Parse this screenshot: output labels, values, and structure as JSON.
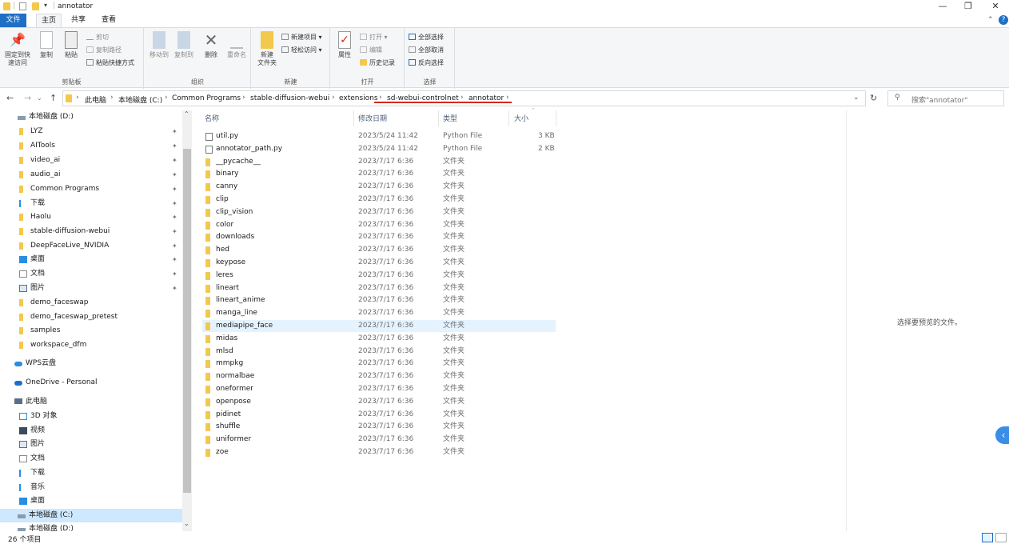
{
  "window": {
    "title": "annotator",
    "controls": {
      "minimize": "—",
      "maximize": "❐",
      "close": "✕"
    }
  },
  "ribbon_tabs": [
    {
      "label": "文件"
    },
    {
      "label": "主页"
    },
    {
      "label": "共享"
    },
    {
      "label": "查看"
    }
  ],
  "ribbon": {
    "clipboard": {
      "pin_label": "固定到快速访问",
      "copy_label": "复制",
      "paste_label": "粘贴",
      "cut_label": "剪切",
      "copy_path_label": "复制路径",
      "paste_shortcut_label": "粘贴快捷方式",
      "group_label": "剪贴板"
    },
    "organize": {
      "move_to_label": "移动到",
      "copy_to_label": "复制到",
      "delete_label": "删除",
      "rename_label": "重命名",
      "group_label": "组织"
    },
    "new": {
      "new_folder_label": "新建\n文件夹",
      "new_item_label": "新建项目",
      "easy_access_label": "轻松访问",
      "group_label": "新建"
    },
    "open": {
      "properties_label": "属性",
      "open_label": "打开",
      "edit_label": "编辑",
      "history_label": "历史记录",
      "group_label": "打开"
    },
    "select": {
      "select_all_label": "全部选择",
      "select_none_label": "全部取消",
      "invert_label": "反向选择",
      "group_label": "选择"
    }
  },
  "address": {
    "nav": {
      "back": "←",
      "forward": "→",
      "up": "↑"
    },
    "breadcrumbs": [
      "此电脑",
      "本地磁盘 (C:)",
      "Common Programs",
      "stable-diffusion-webui",
      "extensions",
      "sd-webui-controlnet",
      "annotator"
    ],
    "search_placeholder": "搜索\"annotator\""
  },
  "nav_pane": {
    "items": [
      {
        "label": "本地磁盘 (D:)",
        "icon": "drive-icon",
        "pinned": false
      },
      {
        "label": "LYZ",
        "icon": "folder-icon",
        "pinned": true
      },
      {
        "label": "AITools",
        "icon": "folder-icon",
        "pinned": true
      },
      {
        "label": "video_ai",
        "icon": "folder-icon",
        "pinned": true
      },
      {
        "label": "audio_ai",
        "icon": "folder-icon",
        "pinned": true
      },
      {
        "label": "Common Programs",
        "icon": "folder-icon",
        "pinned": true
      },
      {
        "label": "下载",
        "icon": "download-icon",
        "pinned": true
      },
      {
        "label": "Haolu",
        "icon": "folder-icon",
        "pinned": true
      },
      {
        "label": "stable-diffusion-webui",
        "icon": "folder-icon",
        "pinned": true
      },
      {
        "label": "DeepFaceLive_NVIDIA",
        "icon": "folder-icon",
        "pinned": true
      },
      {
        "label": "桌面",
        "icon": "desktop-icon",
        "pinned": true
      },
      {
        "label": "文档",
        "icon": "document-icon",
        "pinned": true
      },
      {
        "label": "图片",
        "icon": "picture-icon",
        "pinned": true
      },
      {
        "label": "demo_faceswap",
        "icon": "folder-icon",
        "pinned": false
      },
      {
        "label": "demo_faceswap_pretest",
        "icon": "folder-icon",
        "pinned": false
      },
      {
        "label": "samples",
        "icon": "folder-icon",
        "pinned": false
      },
      {
        "label": "workspace_dfm",
        "icon": "folder-icon",
        "pinned": false
      },
      {
        "label": "WPS云盘",
        "icon": "cloud-icon",
        "pinned": false
      },
      {
        "label": "OneDrive - Personal",
        "icon": "onedrive-icon",
        "pinned": false
      },
      {
        "label": "此电脑",
        "icon": "computer-icon",
        "pinned": false
      },
      {
        "label": "3D 对象",
        "icon": "3d-objects-icon",
        "pinned": false
      },
      {
        "label": "视频",
        "icon": "video-icon",
        "pinned": false
      },
      {
        "label": "图片",
        "icon": "picture-icon",
        "pinned": false
      },
      {
        "label": "文档",
        "icon": "document-icon",
        "pinned": false
      },
      {
        "label": "下载",
        "icon": "download-icon",
        "pinned": false
      },
      {
        "label": "音乐",
        "icon": "music-icon",
        "pinned": false
      },
      {
        "label": "桌面",
        "icon": "desktop-icon",
        "pinned": false
      },
      {
        "label": "本地磁盘 (C:)",
        "icon": "drive-icon",
        "pinned": false,
        "selected": true
      },
      {
        "label": "本地磁盘 (D:)",
        "icon": "drive-icon",
        "pinned": false
      }
    ]
  },
  "file_list": {
    "columns": {
      "name": "名称",
      "date": "修改日期",
      "type": "类型",
      "size": "大小"
    },
    "rows": [
      {
        "name": "util.py",
        "date": "2023/5/24 11:42",
        "type": "Python File",
        "size": "3 KB",
        "kind": "python"
      },
      {
        "name": "annotator_path.py",
        "date": "2023/5/24 11:42",
        "type": "Python File",
        "size": "2 KB",
        "kind": "python"
      },
      {
        "name": "__pycache__",
        "date": "2023/7/17 6:36",
        "type": "文件夹",
        "size": "",
        "kind": "folder"
      },
      {
        "name": "binary",
        "date": "2023/7/17 6:36",
        "type": "文件夹",
        "size": "",
        "kind": "folder"
      },
      {
        "name": "canny",
        "date": "2023/7/17 6:36",
        "type": "文件夹",
        "size": "",
        "kind": "folder"
      },
      {
        "name": "clip",
        "date": "2023/7/17 6:36",
        "type": "文件夹",
        "size": "",
        "kind": "folder"
      },
      {
        "name": "clip_vision",
        "date": "2023/7/17 6:36",
        "type": "文件夹",
        "size": "",
        "kind": "folder"
      },
      {
        "name": "color",
        "date": "2023/7/17 6:36",
        "type": "文件夹",
        "size": "",
        "kind": "folder"
      },
      {
        "name": "downloads",
        "date": "2023/7/17 6:36",
        "type": "文件夹",
        "size": "",
        "kind": "folder"
      },
      {
        "name": "hed",
        "date": "2023/7/17 6:36",
        "type": "文件夹",
        "size": "",
        "kind": "folder"
      },
      {
        "name": "keypose",
        "date": "2023/7/17 6:36",
        "type": "文件夹",
        "size": "",
        "kind": "folder"
      },
      {
        "name": "leres",
        "date": "2023/7/17 6:36",
        "type": "文件夹",
        "size": "",
        "kind": "folder"
      },
      {
        "name": "lineart",
        "date": "2023/7/17 6:36",
        "type": "文件夹",
        "size": "",
        "kind": "folder"
      },
      {
        "name": "lineart_anime",
        "date": "2023/7/17 6:36",
        "type": "文件夹",
        "size": "",
        "kind": "folder"
      },
      {
        "name": "manga_line",
        "date": "2023/7/17 6:36",
        "type": "文件夹",
        "size": "",
        "kind": "folder"
      },
      {
        "name": "mediapipe_face",
        "date": "2023/7/17 6:36",
        "type": "文件夹",
        "size": "",
        "kind": "folder",
        "hover": true
      },
      {
        "name": "midas",
        "date": "2023/7/17 6:36",
        "type": "文件夹",
        "size": "",
        "kind": "folder"
      },
      {
        "name": "mlsd",
        "date": "2023/7/17 6:36",
        "type": "文件夹",
        "size": "",
        "kind": "folder"
      },
      {
        "name": "mmpkg",
        "date": "2023/7/17 6:36",
        "type": "文件夹",
        "size": "",
        "kind": "folder"
      },
      {
        "name": "normalbae",
        "date": "2023/7/17 6:36",
        "type": "文件夹",
        "size": "",
        "kind": "folder"
      },
      {
        "name": "oneformer",
        "date": "2023/7/17 6:36",
        "type": "文件夹",
        "size": "",
        "kind": "folder"
      },
      {
        "name": "openpose",
        "date": "2023/7/17 6:36",
        "type": "文件夹",
        "size": "",
        "kind": "folder"
      },
      {
        "name": "pidinet",
        "date": "2023/7/17 6:36",
        "type": "文件夹",
        "size": "",
        "kind": "folder"
      },
      {
        "name": "shuffle",
        "date": "2023/7/17 6:36",
        "type": "文件夹",
        "size": "",
        "kind": "folder"
      },
      {
        "name": "uniformer",
        "date": "2023/7/17 6:36",
        "type": "文件夹",
        "size": "",
        "kind": "folder"
      },
      {
        "name": "zoe",
        "date": "2023/7/17 6:36",
        "type": "文件夹",
        "size": "",
        "kind": "folder"
      }
    ]
  },
  "preview": {
    "empty_text": "选择要预览的文件。"
  },
  "status": {
    "item_count": "26 个项目"
  },
  "colors": {
    "accent": "#1f6fc5",
    "folder": "#f2c94c",
    "selection": "#cde8ff",
    "hover": "#e5f3ff",
    "highlight": "#d7261e"
  }
}
